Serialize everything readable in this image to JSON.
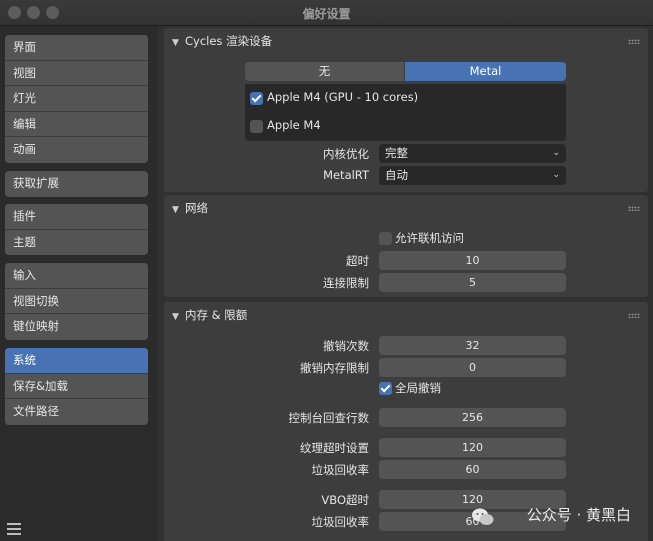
{
  "window": {
    "title": "偏好设置"
  },
  "sidebar": {
    "groups": [
      [
        "界面",
        "视图",
        "灯光",
        "编辑",
        "动画"
      ],
      [
        "获取扩展"
      ],
      [
        "插件",
        "主题"
      ],
      [
        "输入",
        "视图切换",
        "键位映射"
      ],
      [
        "系统",
        "保存&加载",
        "文件路径"
      ]
    ],
    "active": "系统"
  },
  "cycles": {
    "header": "Cycles 渲染设备",
    "tabs": [
      "无",
      "Metal"
    ],
    "active_tab": "Metal",
    "devices": [
      {
        "label": "Apple M4 (GPU - 10 cores)",
        "checked": true
      },
      {
        "label": "Apple M4",
        "checked": false
      }
    ],
    "kernel_label": "内核优化",
    "kernel_value": "完整",
    "metalrt_label": "MetalRT",
    "metalrt_value": "自动"
  },
  "network": {
    "header": "网络",
    "allow_online_label": "允许联机访问",
    "allow_online": false,
    "timeout_label": "超时",
    "timeout_value": "10",
    "conn_limit_label": "连接限制",
    "conn_limit_value": "5"
  },
  "memory": {
    "header": "内存 & 限额",
    "undo_steps_label": "撤销次数",
    "undo_steps_value": "32",
    "undo_mem_label": "撤销内存限制",
    "undo_mem_value": "0",
    "global_undo_label": "全局撤销",
    "global_undo": true,
    "console_label": "控制台回查行数",
    "console_value": "256",
    "tex_timeout_label": "纹理超时设置",
    "tex_timeout_value": "120",
    "tex_gc_label": "垃圾回收率",
    "tex_gc_value": "60",
    "vbo_timeout_label": "VBO超时",
    "vbo_timeout_value": "120",
    "vbo_gc_label": "垃圾回收率",
    "vbo_gc_value": "60"
  },
  "watermark": {
    "text": "公众号 · 黄黑白"
  },
  "colors": {
    "accent": "#4772b3",
    "panel": "#3d3d3d",
    "background": "#303030",
    "sidebar_item": "#545454"
  },
  "icons": [
    "close-dot",
    "minimize-dot",
    "zoom-dot",
    "chevron-down-icon",
    "grip-icon",
    "checkbox",
    "hamburger-menu-icon"
  ]
}
